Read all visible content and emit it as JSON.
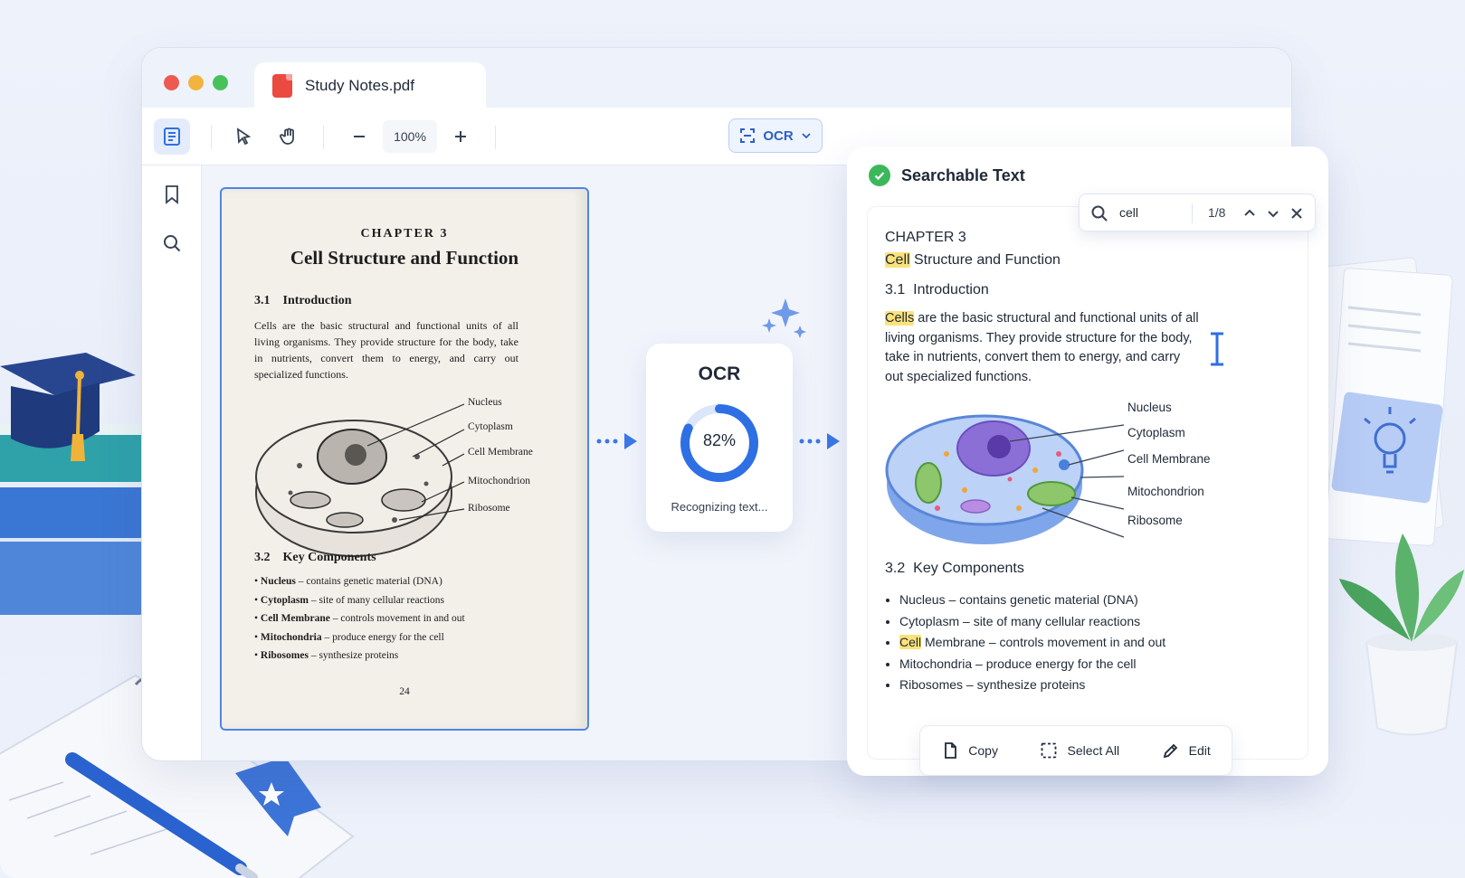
{
  "window": {
    "tab_title": "Study Notes.pdf",
    "zoom": "100%",
    "ocr_button": "OCR"
  },
  "scan": {
    "chapter": "CHAPTER 3",
    "title": "Cell Structure and Function",
    "section1_num": "3.1",
    "section1_title": "Introduction",
    "paragraph": "Cells are the basic structural and functional units of all living organisms. They provide structure for the body, take in nutrients, convert them to energy, and carry out specialized functions.",
    "labels": [
      "Nucleus",
      "Cytoplasm",
      "Cell Membrane",
      "Mitochondrion",
      "Ribosome"
    ],
    "section2_num": "3.2",
    "section2_title": "Key Components",
    "bullets": [
      {
        "term": "Nucleus",
        "desc": " – contains genetic material (DNA)"
      },
      {
        "term": "Cytoplasm",
        "desc": " – site of many cellular reactions"
      },
      {
        "term": "Cell Membrane",
        "desc": " – controls movement in and out"
      },
      {
        "term": "Mitochondria",
        "desc": " – produce energy for the cell"
      },
      {
        "term": "Ribosomes",
        "desc": " – synthesize proteins"
      }
    ],
    "page_number": "24"
  },
  "ocr": {
    "title": "OCR",
    "progress_text": "82%",
    "progress": 0.82,
    "status": "Recognizing text..."
  },
  "panel": {
    "title": "Searchable Text",
    "search_query": "cell",
    "match_count": "1/8",
    "chapter": "CHAPTER 3",
    "title_hl": "Cell",
    "title_rest": " Structure and Function",
    "section1_num": "3.1",
    "section1_title": "Introduction",
    "para_hl": "Cells",
    "para_rest": " are the basic structural and functional units of all living organisms. They provide structure for the body, take in nutrients, convert them to energy, and carry out specialized functions.",
    "labels": [
      "Nucleus",
      "Cytoplasm",
      "Cell Membrane",
      "Mitochondrion",
      "Ribosome"
    ],
    "section2_num": "3.2",
    "section2_title": "Key Components",
    "bullets": [
      "Nucleus – contains genetic material (DNA)",
      "Cytoplasm – site of many cellular reactions",
      "Membrane – controls movement in and out",
      "Mitochondria – produce energy for the cell",
      "Ribosomes – synthesize proteins"
    ],
    "bullet3_hl": "Cell",
    "actions": {
      "copy": "Copy",
      "select_all": "Select All",
      "edit": "Edit"
    }
  },
  "colors": {
    "accent": "#2f6fe4",
    "highlight": "#fbe27a",
    "success": "#3bb85a"
  }
}
